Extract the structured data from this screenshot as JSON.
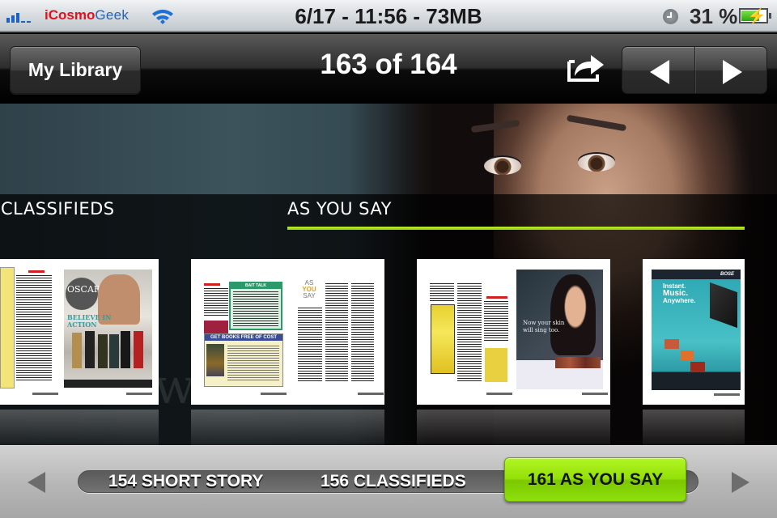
{
  "status_bar": {
    "carrier_part1": "iCosmo",
    "carrier_part2": "Geek",
    "center_text": "6/17 - 11:56 - 73MB",
    "battery_percent": "31 %",
    "battery_level": 0.31,
    "icons": [
      "signal-icon",
      "wifi-icon",
      "clock-icon",
      "battery-charging-icon"
    ]
  },
  "nav_bar": {
    "back_label": "My Library",
    "title": "163 of 164",
    "share_icon": "share-icon",
    "prev_icon": "triangle-left-icon",
    "next_icon": "triangle-right-icon"
  },
  "content": {
    "sections": [
      {
        "label": "CLASSIFIEDS",
        "selected": false
      },
      {
        "label": "AS YOU SAY",
        "selected": true
      }
    ],
    "accent_color": "#a6dd19",
    "thumbnails": [
      {
        "title": "Classifieds / Oscar ad spread",
        "ad_text": "OSCAR",
        "ad_tagline": "BELIEVE IN ACTION"
      },
      {
        "title": "Book offer / As You Say spread",
        "left_heading": "GET BOOKS FREE OF COST",
        "box_heading": "BAIT TALK",
        "right_heading_1": "AS",
        "right_heading_2": "YOU",
        "right_heading_3": "SAY"
      },
      {
        "title": "Article / Skin ad spread",
        "ad_text": "Now your skin will sing too."
      },
      {
        "title": "Bose ad page",
        "ad_text_1": "Instant.",
        "ad_text_2": "Music.",
        "ad_text_3": "Anywhere.",
        "brand": "BOSE"
      }
    ]
  },
  "bottom_bar": {
    "prev_icon": "triangle-left-icon",
    "next_icon": "triangle-right-icon",
    "chips": [
      {
        "label": "154 SHORT STORY",
        "active": false
      },
      {
        "label": "156 CLASSIFIEDS",
        "active": false
      },
      {
        "label": "161 AS YOU SAY",
        "active": true
      }
    ],
    "active_color": "#9be60e"
  }
}
